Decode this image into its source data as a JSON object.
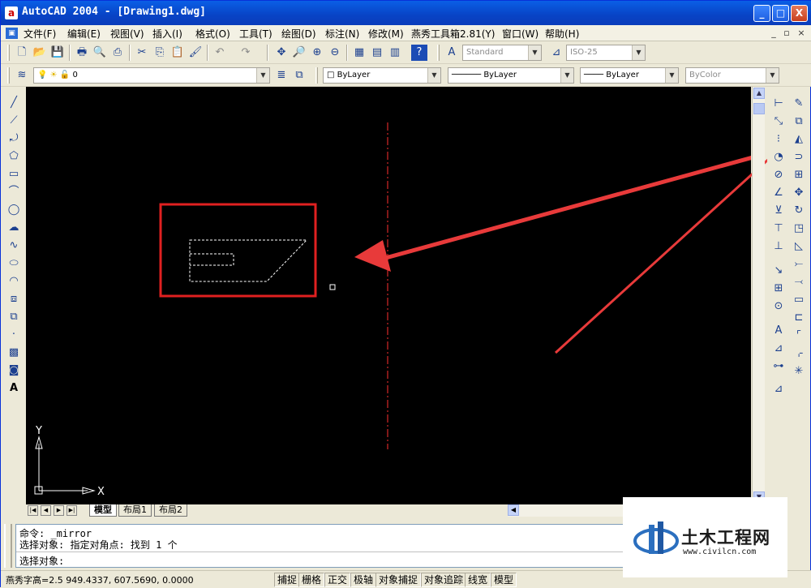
{
  "window": {
    "title": "AutoCAD 2004 - [Drawing1.dwg]",
    "app_icon": "a",
    "controls": [
      "_",
      "□",
      "X"
    ]
  },
  "menu": {
    "items": [
      "文件(F)",
      "编辑(E)",
      "视图(V)",
      "插入(I)",
      "格式(O)",
      "工具(T)",
      "绘图(D)",
      "标注(N)",
      "修改(M)",
      "燕秀工具箱2.81(Y)",
      "窗口(W)",
      "帮助(H)"
    ],
    "mdi_controls": [
      "_",
      "▫",
      "×"
    ]
  },
  "toolbar_standard": {
    "text_style": "Standard",
    "dim_style": "ISO-25"
  },
  "toolbar_layers": {
    "layer_name": "0",
    "color": "ByLayer",
    "linetype": "ByLayer",
    "lineweight": "ByLayer",
    "plotstyle": "ByColor"
  },
  "drawing": {
    "ucs_x_label": "X",
    "ucs_y_label": "Y",
    "background": "#000000",
    "mirror_line_color": "#ff3030",
    "highlight_box_color": "#e02020",
    "arrow_color": "#e83a3a"
  },
  "layout_tabs": [
    "模型",
    "布局1",
    "布局2"
  ],
  "command": {
    "line1": "命令: _mirror",
    "line2": "选择对象: 指定对角点: 找到 1 个",
    "prompt": "选择对象:"
  },
  "status": {
    "coords": "燕秀字高=2.5  949.4337,   607.5690, 0.0000",
    "toggles": [
      "捕捉",
      "栅格",
      "正交",
      "极轴",
      "对象捕捉",
      "对象追踪",
      "线宽",
      "模型"
    ]
  },
  "watermark": {
    "title": "土木工程网",
    "url": "www.civilcn.com"
  }
}
